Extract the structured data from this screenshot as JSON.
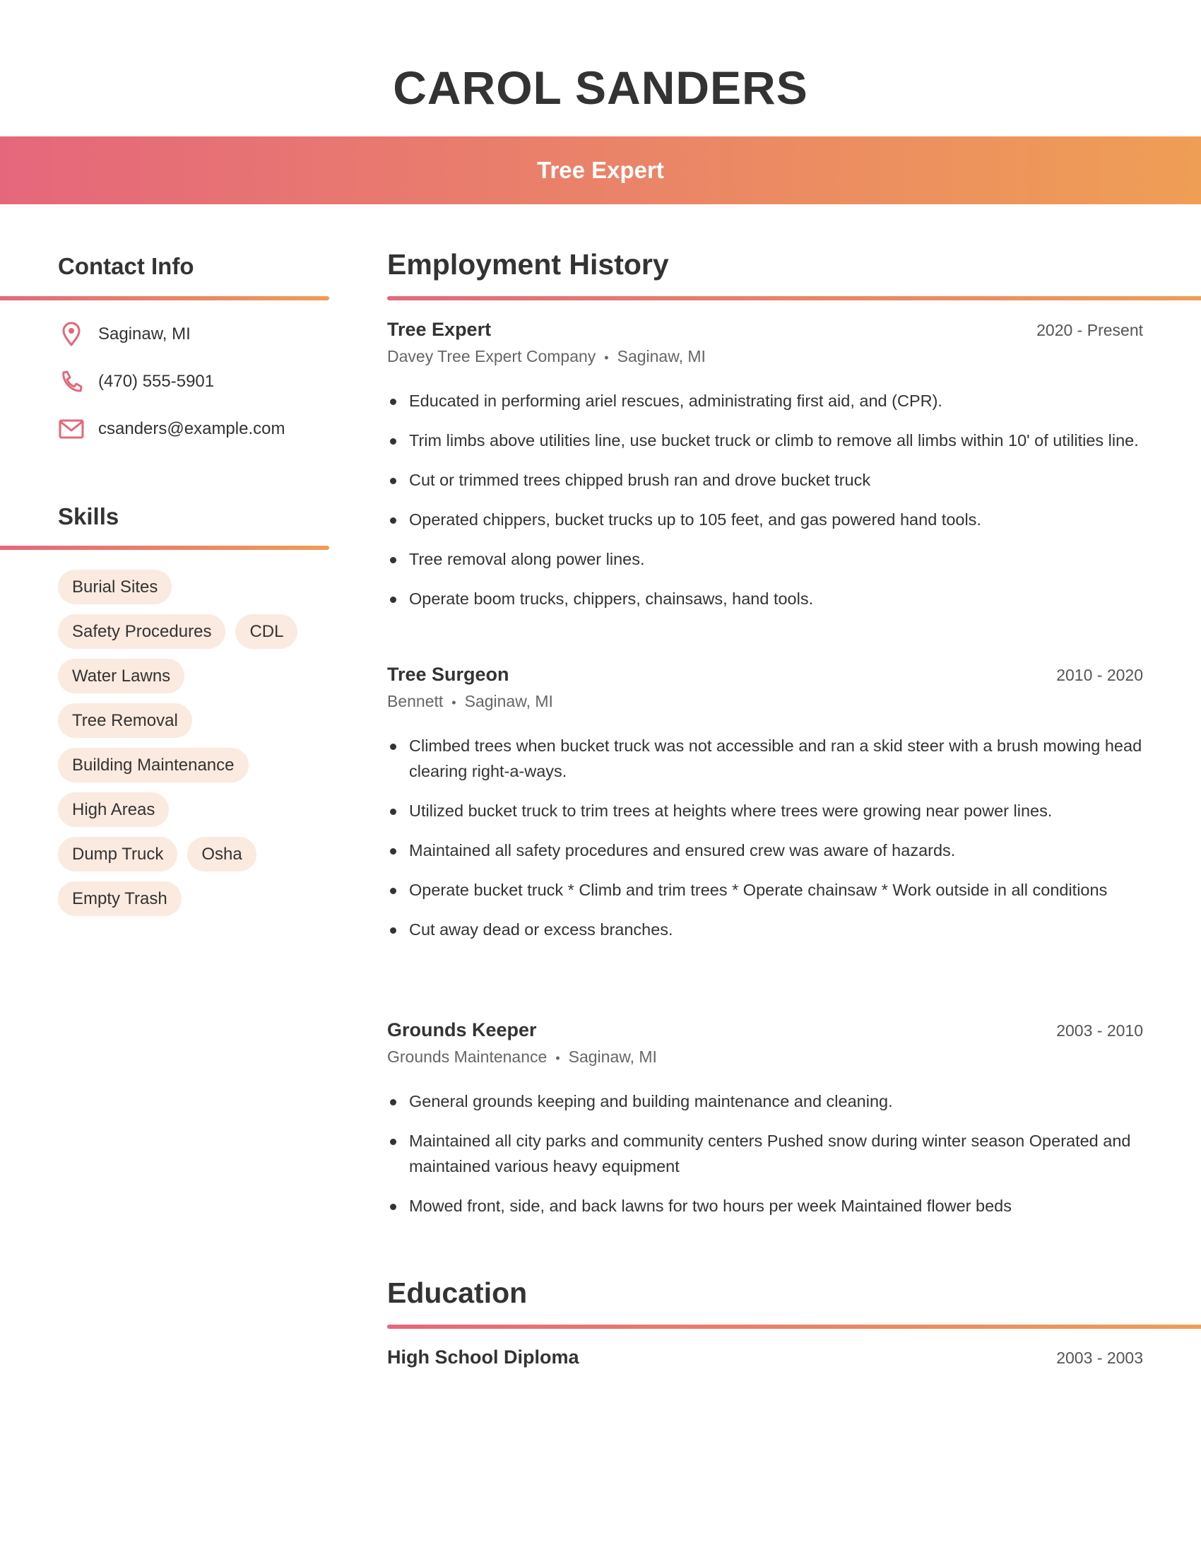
{
  "header": {
    "name": "CAROL SANDERS",
    "title": "Tree Expert"
  },
  "colors": {
    "gradient_start": "#E5677C",
    "gradient_end": "#EF9E55",
    "pill_bg": "#FBEADF",
    "icon": "#E5677A",
    "text": "#333333"
  },
  "contact": {
    "heading": "Contact Info",
    "items": [
      {
        "icon": "location-pin-icon",
        "text": "Saginaw, MI"
      },
      {
        "icon": "phone-icon",
        "text": "(470) 555-5901"
      },
      {
        "icon": "mail-icon",
        "text": "csanders@example.com"
      }
    ]
  },
  "skills": {
    "heading": "Skills",
    "rows": [
      [
        "Burial Sites"
      ],
      [
        "Safety Procedures",
        "CDL"
      ],
      [
        "Water Lawns"
      ],
      [
        "Tree Removal"
      ],
      [
        "Building Maintenance"
      ],
      [
        "High Areas"
      ],
      [
        "Dump Truck",
        "Osha"
      ],
      [
        "Empty Trash"
      ]
    ]
  },
  "employment": {
    "heading": "Employment History",
    "jobs": [
      {
        "title": "Tree Expert",
        "dates": "2020 - Present",
        "company": "Davey Tree Expert Company",
        "location": "Saginaw, MI",
        "bullets": [
          "Educated in performing ariel rescues, administrating first aid, and (CPR).",
          "Trim limbs above utilities line, use bucket truck or climb to remove all limbs within 10' of utilities line.",
          "Cut or trimmed trees chipped brush ran and drove bucket truck",
          "Operated chippers, bucket trucks up to 105 feet, and gas powered hand tools.",
          "Tree removal along power lines.",
          "Operate boom trucks, chippers, chainsaws, hand tools."
        ]
      },
      {
        "title": "Tree Surgeon",
        "dates": "2010 - 2020",
        "company": "Bennett",
        "location": "Saginaw, MI",
        "bullets": [
          "Climbed trees when bucket truck was not accessible and ran a skid steer with a brush mowing head clearing right-a-ways.",
          "Utilized bucket truck to trim trees at heights where trees were growing near power lines.",
          "Maintained all safety procedures and ensured crew was aware of hazards.",
          "Operate bucket truck * Climb and trim trees * Operate chainsaw * Work outside in all conditions",
          "Cut away dead or excess branches."
        ]
      },
      {
        "title": "Grounds Keeper",
        "dates": "2003 - 2010",
        "company": "Grounds Maintenance",
        "location": "Saginaw, MI",
        "bullets": [
          "General grounds keeping and building maintenance and cleaning.",
          "Maintained all city parks and community centers Pushed snow during winter season Operated and maintained various heavy equipment",
          "Mowed front, side, and back lawns for two hours per week Maintained flower beds"
        ]
      }
    ]
  },
  "education": {
    "heading": "Education",
    "items": [
      {
        "degree": "High School Diploma",
        "dates": "2003 - 2003"
      }
    ]
  }
}
